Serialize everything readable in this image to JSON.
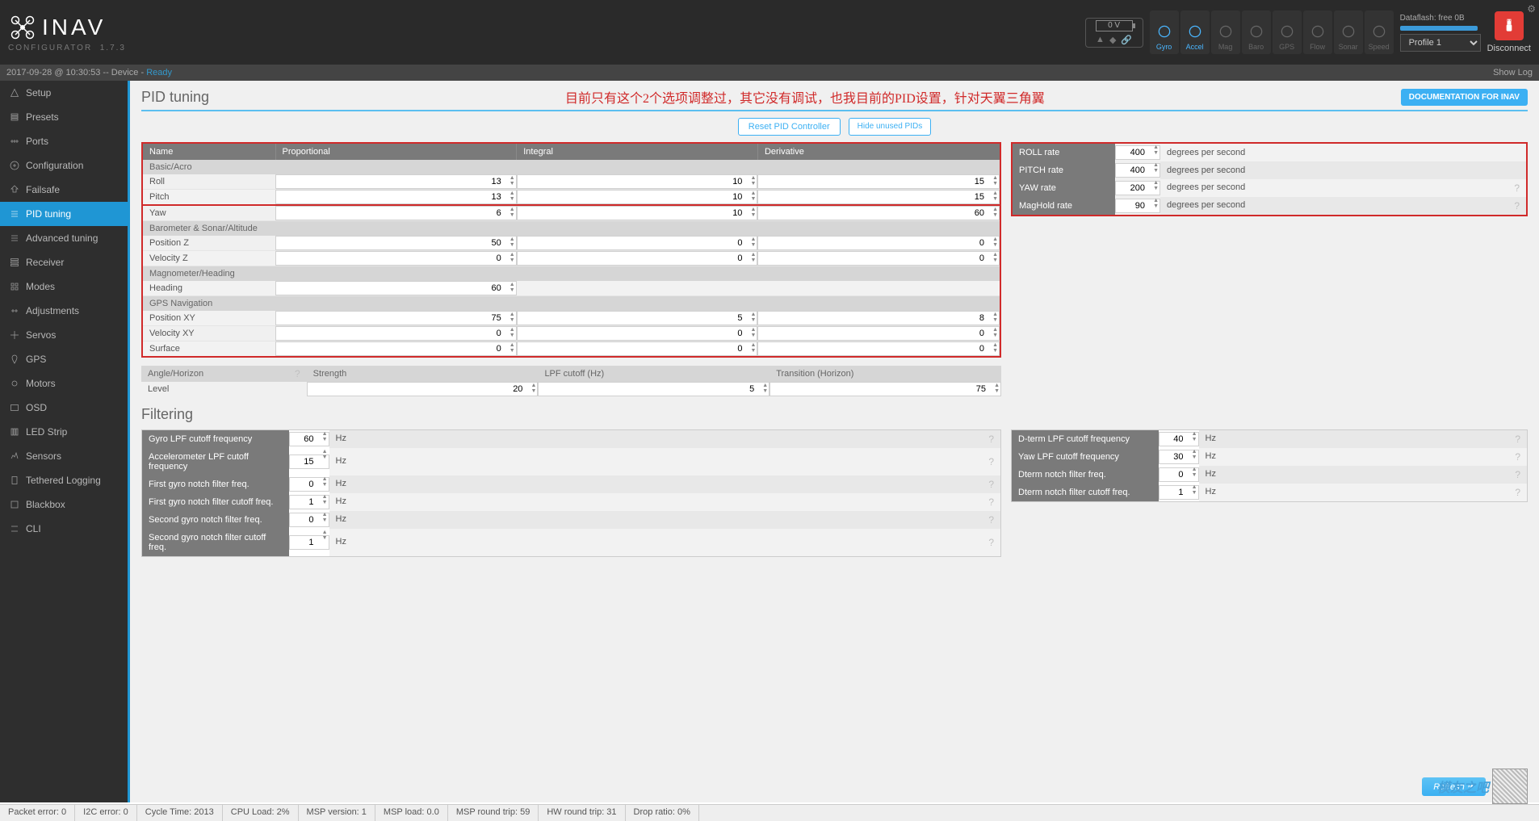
{
  "app": {
    "name": "INAV",
    "subtitle": "CONFIGURATOR",
    "version": "1.7.3"
  },
  "status": {
    "timestamp": "2017-09-28 @ 10:30:53 -- Device - ",
    "state": "Ready",
    "show_log": "Show Log"
  },
  "battery": {
    "voltage": "0 V"
  },
  "sensors": [
    {
      "name": "Gyro",
      "active": true
    },
    {
      "name": "Accel",
      "active": true
    },
    {
      "name": "Mag",
      "active": false
    },
    {
      "name": "Baro",
      "active": false
    },
    {
      "name": "GPS",
      "active": false
    },
    {
      "name": "Flow",
      "active": false
    },
    {
      "name": "Sonar",
      "active": false
    },
    {
      "name": "Speed",
      "active": false
    }
  ],
  "dataflash": "Dataflash: free 0B",
  "profile": "Profile 1",
  "disconnect": "Disconnect",
  "sidebar": [
    "Setup",
    "Presets",
    "Ports",
    "Configuration",
    "Failsafe",
    "PID tuning",
    "Advanced tuning",
    "Receiver",
    "Modes",
    "Adjustments",
    "Servos",
    "GPS",
    "Motors",
    "OSD",
    "LED Strip",
    "Sensors",
    "Tethered Logging",
    "Blackbox",
    "CLI"
  ],
  "sidebar_active": 5,
  "page": {
    "title": "PID tuning",
    "red_note": "目前只有这个2个选项调整过，其它没有调试，也我目前的PID设置，针对天翼三角翼",
    "doc_btn": "DOCUMENTATION FOR INAV",
    "reset_btn": "Reset PID Controller",
    "hide_btn": "Hide unused PIDs"
  },
  "pid_headers": [
    "Name",
    "Proportional",
    "Integral",
    "Derivative"
  ],
  "pid_groups": [
    {
      "title": "Basic/Acro",
      "rows": [
        {
          "name": "Roll",
          "p": 13,
          "i": 10,
          "d": 15
        },
        {
          "name": "Pitch",
          "p": 13,
          "i": 10,
          "d": 15
        },
        {
          "name": "Yaw",
          "p": 6,
          "i": 10,
          "d": 60
        }
      ]
    },
    {
      "title": "Barometer & Sonar/Altitude",
      "rows": [
        {
          "name": "Position Z",
          "p": 50,
          "i": 0,
          "d": 0
        },
        {
          "name": "Velocity Z",
          "p": 0,
          "i": 0,
          "d": 0
        }
      ]
    },
    {
      "title": "Magnometer/Heading",
      "rows": [
        {
          "name": "Heading",
          "p": 60,
          "i": null,
          "d": null
        }
      ]
    },
    {
      "title": "GPS Navigation",
      "rows": [
        {
          "name": "Position XY",
          "p": 75,
          "i": 5,
          "d": 8
        },
        {
          "name": "Velocity XY",
          "p": 0,
          "i": 0,
          "d": 0
        },
        {
          "name": "Surface",
          "p": 0,
          "i": 0,
          "d": 0
        }
      ]
    }
  ],
  "level": {
    "headers": [
      "Angle/Horizon",
      "Strength",
      "LPF cutoff (Hz)",
      "Transition (Horizon)"
    ],
    "row": {
      "name": "Level",
      "s": 20,
      "l": 5,
      "t": 75
    }
  },
  "rates": [
    {
      "label": "ROLL rate",
      "val": 400,
      "unit": "degrees per second"
    },
    {
      "label": "PITCH rate",
      "val": 400,
      "unit": "degrees per second"
    },
    {
      "label": "YAW rate",
      "val": 200,
      "unit": "degrees per second"
    },
    {
      "label": "MagHold rate",
      "val": 90,
      "unit": "degrees per second"
    }
  ],
  "filtering_title": "Filtering",
  "filters_left": [
    {
      "label": "Gyro LPF cutoff frequency",
      "val": 60,
      "unit": "Hz"
    },
    {
      "label": "Accelerometer LPF cutoff frequency",
      "val": 15,
      "unit": "Hz"
    },
    {
      "label": "First gyro notch filter freq.",
      "val": 0,
      "unit": "Hz"
    },
    {
      "label": "First gyro notch filter cutoff freq.",
      "val": 1,
      "unit": "Hz"
    },
    {
      "label": "Second gyro notch filter freq.",
      "val": 0,
      "unit": "Hz"
    },
    {
      "label": "Second gyro notch filter cutoff freq.",
      "val": 1,
      "unit": "Hz"
    }
  ],
  "filters_right": [
    {
      "label": "D-term LPF cutoff frequency",
      "val": 40,
      "unit": "Hz"
    },
    {
      "label": "Yaw LPF cutoff frequency",
      "val": 30,
      "unit": "Hz"
    },
    {
      "label": "Dterm notch filter freq.",
      "val": 0,
      "unit": "Hz"
    },
    {
      "label": "Dterm notch filter cutoff freq.",
      "val": 1,
      "unit": "Hz"
    }
  ],
  "refresh": "Refresh",
  "watermark": "模友之吧",
  "footer": {
    "packet_error": "Packet error: 0",
    "i2c_error": "I2C error: 0",
    "cycle_time": "Cycle Time: 2013",
    "cpu_load": "CPU Load: 2%",
    "msp_version": "MSP version: 1",
    "msp_load": "MSP load: 0.0",
    "msp_roundtrip": "MSP round trip: 59",
    "hw_roundtrip": "HW round trip: 31",
    "drop_ratio": "Drop ratio: 0%"
  }
}
